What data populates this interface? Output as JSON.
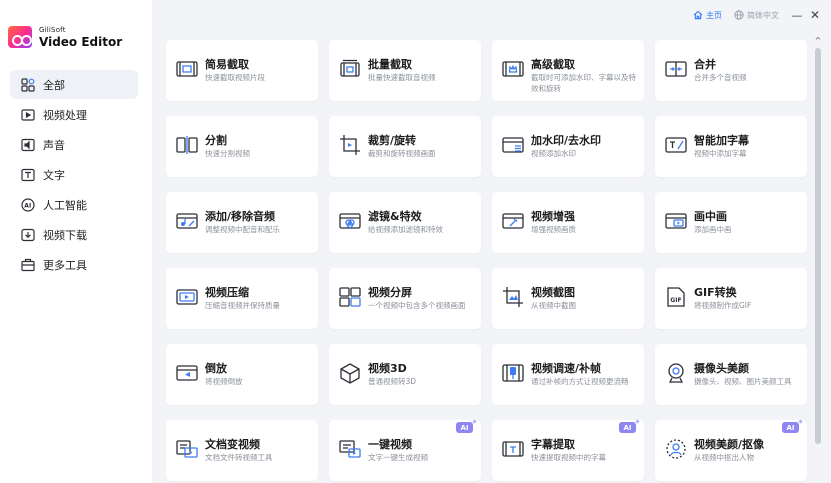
{
  "app": {
    "brand": "GiliSoft",
    "name": "Video Editor"
  },
  "topbar": {
    "home_label": "主页",
    "language_label": "简体中文",
    "minimize_symbol": "—",
    "close_symbol": "✕"
  },
  "sidebar": {
    "items": [
      {
        "label": "全部",
        "icon": "grid-icon"
      },
      {
        "label": "视频处理",
        "icon": "video-play-icon"
      },
      {
        "label": "声音",
        "icon": "sound-icon"
      },
      {
        "label": "文字",
        "icon": "text-icon"
      },
      {
        "label": "人工智能",
        "icon": "ai-icon"
      },
      {
        "label": "视频下载",
        "icon": "download-icon"
      },
      {
        "label": "更多工具",
        "icon": "toolbox-icon"
      }
    ]
  },
  "ai_badge_text": "AI",
  "cards": [
    {
      "title": "简易截取",
      "desc": "快速截取视频片段"
    },
    {
      "title": "批量截取",
      "desc": "批量快速截取音视频"
    },
    {
      "title": "高级截取",
      "desc": "截取时可添加水印、字幕以及特效和旋转"
    },
    {
      "title": "合并",
      "desc": "合并多个音视频"
    },
    {
      "title": "分割",
      "desc": "快速分割视频"
    },
    {
      "title": "裁剪/旋转",
      "desc": "裁剪和旋转视频画面"
    },
    {
      "title": "加水印/去水印",
      "desc": "视频添加水印"
    },
    {
      "title": "智能加字幕",
      "desc": "视频中添加字幕"
    },
    {
      "title": "添加/移除音频",
      "desc": "调整视频中配音和配乐"
    },
    {
      "title": "滤镜&特效",
      "desc": "给视频添加滤镜和特效"
    },
    {
      "title": "视频增强",
      "desc": "增强视频画质"
    },
    {
      "title": "画中画",
      "desc": "添加画中画"
    },
    {
      "title": "视频压缩",
      "desc": "压缩音视频并保持质量"
    },
    {
      "title": "视频分屏",
      "desc": "一个视频中包含多个视频画面"
    },
    {
      "title": "视频截图",
      "desc": "从视频中截图"
    },
    {
      "title": "GIF转换",
      "desc": "将视频制作成GIF"
    },
    {
      "title": "倒放",
      "desc": "将视频倒放"
    },
    {
      "title": "视频3D",
      "desc": "普通视频转3D"
    },
    {
      "title": "视频调速/补帧",
      "desc": "通过补帧的方式让视频更流畅"
    },
    {
      "title": "摄像头美颜",
      "desc": "摄像头、视频、图片美颜工具"
    },
    {
      "title": "文档变视频",
      "desc": "文档文件转视频工具"
    },
    {
      "title": "一键视频",
      "desc": "文字一键生成视频",
      "ai": true
    },
    {
      "title": "字幕提取",
      "desc": "快速提取视频中的字幕",
      "ai": true
    },
    {
      "title": "视频美颜/抠像",
      "desc": "从视频中抠出人物",
      "ai": true
    }
  ],
  "colors": {
    "accent": "#2f7bf5",
    "sidebar_active": "#eef1f6",
    "content_bg": "#f3f4f7",
    "ai_badge": "#8e86f2",
    "icon_stroke": "#2b2f36",
    "icon_accent": "#3d7cf0"
  }
}
